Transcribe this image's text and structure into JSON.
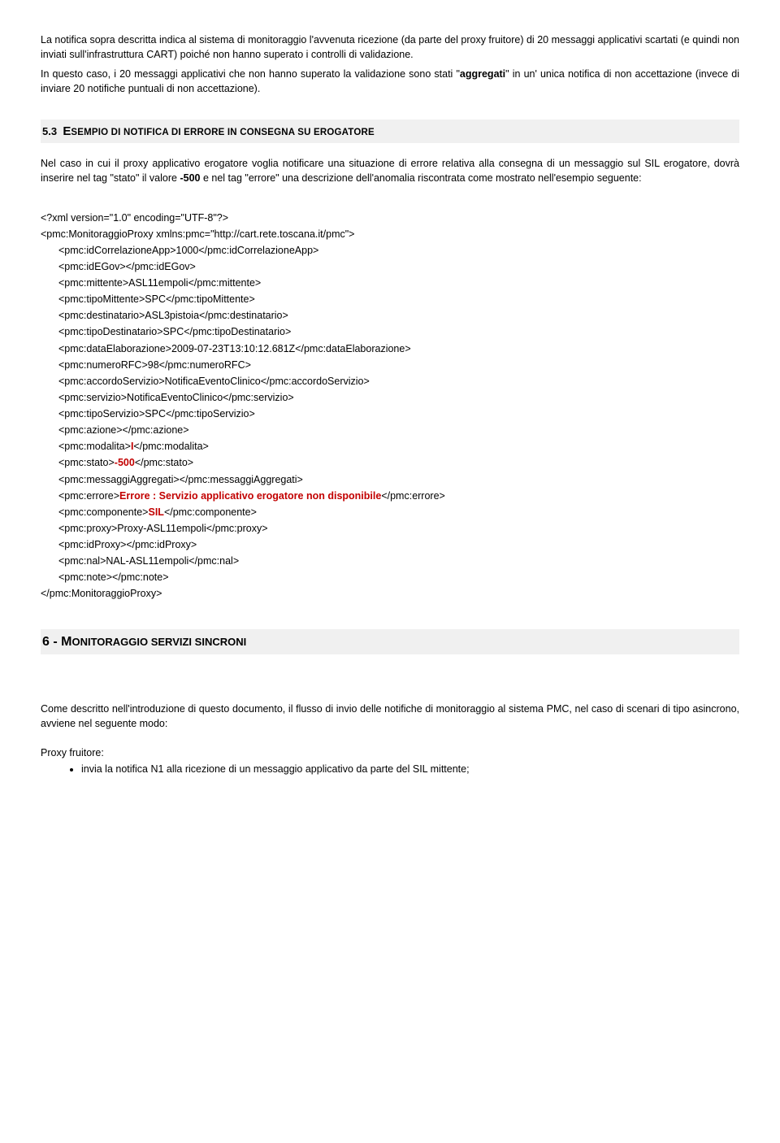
{
  "intro": {
    "p1a": "La notifica sopra descritta indica al sistema di monitoraggio l'avvenuta ricezione (da parte del proxy fruitore) di 20 messaggi applicativi scartati (e quindi non inviati sull'infrastruttura CART) poiché non hanno superato i controlli di validazione.",
    "p1b_pre": "In questo caso, i 20 messaggi applicativi che non hanno superato la validazione sono stati \"",
    "p1b_bold": "aggregati",
    "p1b_post": "\" in un' unica notifica di non accettazione (invece di inviare 20 notifiche puntuali di non accettazione)."
  },
  "sec53": {
    "num": "5.3",
    "title_big": "E",
    "title_rest": "SEMPIO DI NOTIFICA DI ERRORE IN CONSEGNA SU EROGATORE",
    "p_pre": "Nel caso in cui il proxy applicativo erogatore voglia notificare una situazione di errore relativa alla consegna di un messaggio sul SIL erogatore, dovrà inserire nel tag \"stato\" il valore ",
    "p_bold1": "-500",
    "p_mid": " e nel tag \"errore\" una descrizione dell'anomalia riscontrata come mostrato nell'esempio seguente:"
  },
  "xml": {
    "l01": "<?xml version=\"1.0\" encoding=\"UTF-8\"?>",
    "l02": "<pmc:MonitoraggioProxy xmlns:pmc=\"http://cart.rete.toscana.it/pmc\">",
    "l03": "<pmc:idCorrelazioneApp>1000</pmc:idCorrelazioneApp>",
    "l04": "<pmc:idEGov></pmc:idEGov>",
    "l05": "<pmc:mittente>ASL11empoli</pmc:mittente>",
    "l06": "<pmc:tipoMittente>SPC</pmc:tipoMittente>",
    "l07": "<pmc:destinatario>ASL3pistoia</pmc:destinatario>",
    "l08": "<pmc:tipoDestinatario>SPC</pmc:tipoDestinatario>",
    "l09": "<pmc:dataElaborazione>2009-07-23T13:10:12.681Z</pmc:dataElaborazione>",
    "l10": "<pmc:numeroRFC>98</pmc:numeroRFC>",
    "l11": "<pmc:accordoServizio>NotificaEventoClinico</pmc:accordoServizio>",
    "l12": "<pmc:servizio>NotificaEventoClinico</pmc:servizio>",
    "l13": "<pmc:tipoServizio>SPC</pmc:tipoServizio>",
    "l14": "<pmc:azione></pmc:azione>",
    "l15a": "<pmc:modalita>",
    "l15b": "I",
    "l15c": "</pmc:modalita>",
    "l16a": "<pmc:stato>",
    "l16b": "-500",
    "l16c": "</pmc:stato>",
    "l17": "<pmc:messaggiAggregati></pmc:messaggiAggregati>",
    "l18a": "<pmc:errore>",
    "l18b": "Errore : Servizio applicativo erogatore non disponibile",
    "l18c": "</pmc:errore>",
    "l19a": "<pmc:componente>",
    "l19b": "SIL",
    "l19c": "</pmc:componente>",
    "l20": "<pmc:proxy>Proxy-ASL11empoli</pmc:proxy>",
    "l21": "<pmc:idProxy></pmc:idProxy>",
    "l22": "<pmc:nal>NAL-ASL11empoli</pmc:nal>",
    "l23": "<pmc:note></pmc:note>",
    "l24": "</pmc:MonitoraggioProxy>"
  },
  "sec6": {
    "num_big": "6 - M",
    "title_rest": "ONITORAGGIO SERVIZI SINCRONI",
    "p1": "Come descritto nell'introduzione di questo documento, il flusso di invio delle notifiche di monitoraggio al sistema PMC, nel caso di scenari di tipo asincrono, avviene nel seguente modo:",
    "proxy_label": "Proxy fruitore:",
    "bullet1": "invia la notifica N1 alla ricezione di un messaggio applicativo da parte del SIL mittente;"
  }
}
